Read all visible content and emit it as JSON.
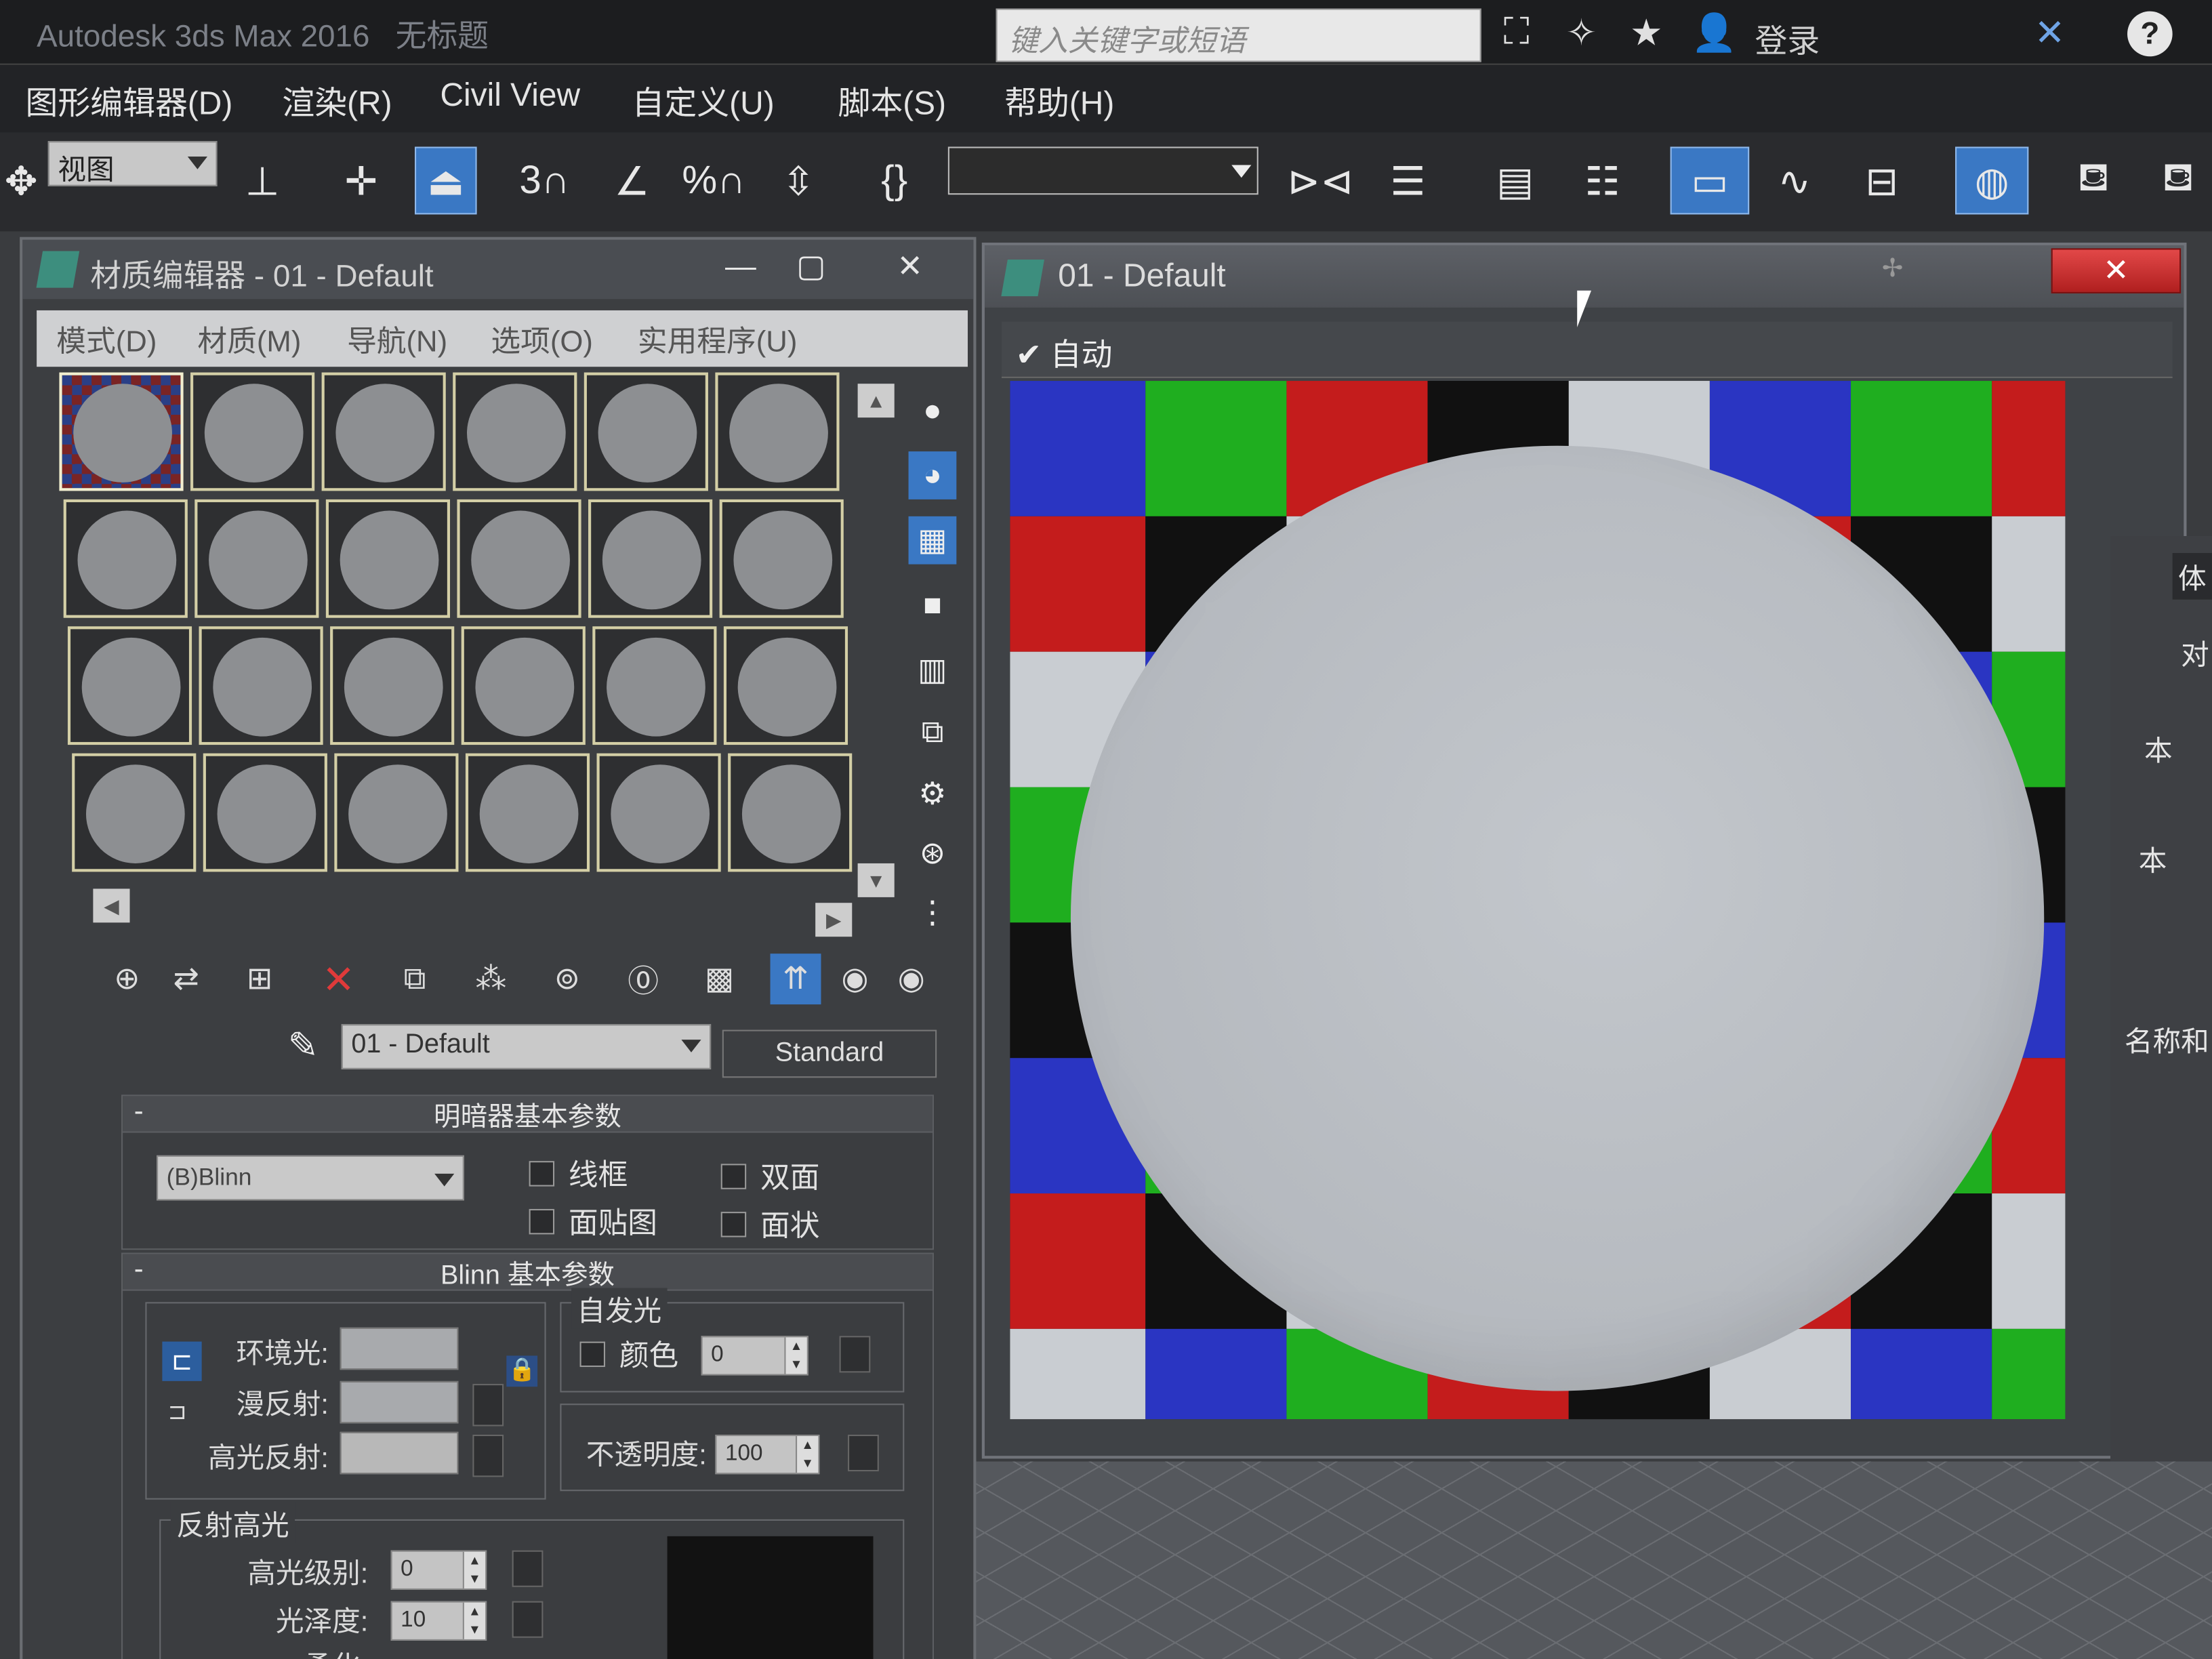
{
  "app": {
    "title": "Autodesk 3ds Max 2016",
    "doc": "无标题"
  },
  "search": {
    "placeholder": "键入关键字或短语"
  },
  "login": "登录",
  "help": "?",
  "menus": [
    "图形编辑器(D)",
    "渲染(R)",
    "Civil View",
    "自定义(U)",
    "脚本(S)",
    "帮助(H)"
  ],
  "toolbar": {
    "view": "视图",
    "snap3": "3",
    "snap_pct": "%"
  },
  "material_editor": {
    "title": "材质编辑器 - 01 - Default",
    "menu": [
      "模式(D)",
      "材质(M)",
      "导航(N)",
      "选项(O)",
      "实用程序(U)"
    ],
    "material_name": "01 - Default",
    "material_type": "Standard",
    "shader_rollout": {
      "title": "明暗器基本参数",
      "shader": "(B)Blinn",
      "checks": [
        "线框",
        "双面",
        "面贴图",
        "面状"
      ]
    },
    "blinn_rollout": {
      "title": "Blinn 基本参数",
      "ambient": "环境光:",
      "diffuse": "漫反射:",
      "specular": "高光反射:",
      "self_illum": {
        "title": "自发光",
        "color_label": "颜色",
        "value": "0"
      },
      "opacity": {
        "label": "不透明度:",
        "value": "100"
      },
      "spec_highlights": {
        "title": "反射高光",
        "level_label": "高光级别:",
        "level": "0",
        "gloss_label": "光泽度:",
        "gloss": "10",
        "soften_label": "柔化:"
      }
    }
  },
  "preview": {
    "title": "01 - Default",
    "auto": "自动"
  },
  "right_panel": {
    "t1": "体",
    "t2": "对",
    "t3": "本",
    "t4": "本",
    "t5": "名称和"
  },
  "colors": {
    "accent": "#3a78c4",
    "close": "#d03030",
    "checker": [
      "#1fae1f",
      "#2a35c2",
      "#c41c1c",
      "#111111",
      "#c9cdd2"
    ]
  }
}
